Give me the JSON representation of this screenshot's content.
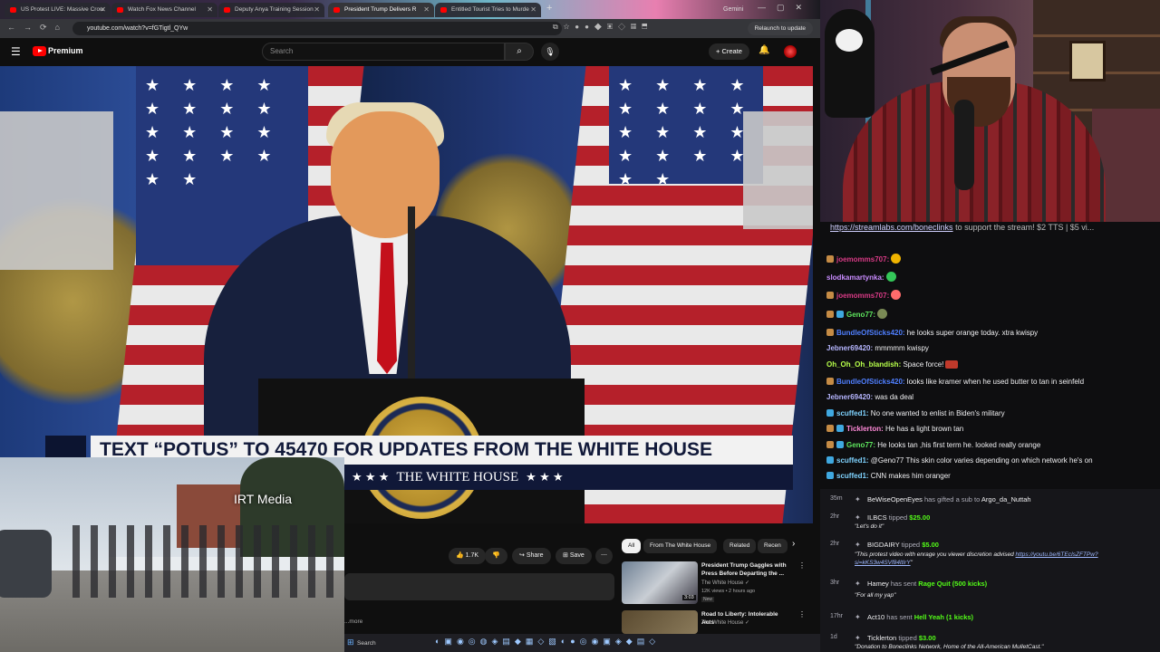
{
  "colors": {
    "youtube_red": "#ff0000",
    "chat_bg": "#0e0e10",
    "events_bg": "#16161a",
    "chyron_navy": "#101838"
  },
  "browser": {
    "tabs": [
      {
        "label": "US Protest LIVE: Massive Crow"
      },
      {
        "label": "Watch Fox News Channel"
      },
      {
        "label": "Deputy Anya Training Session"
      },
      {
        "label": "President Trump Delivers R"
      },
      {
        "label": "Entitled Tourist Tries to Murde"
      }
    ],
    "gemini_tab": "Gemini",
    "new_tab_icon": "plus-icon",
    "url": "youtube.com/watch?v=fGTigtl_QYw",
    "relaunch_label": "Relaunch to update"
  },
  "youtube": {
    "brand": "Premium",
    "search_placeholder": "Search",
    "create_label": "+ Create",
    "video": {
      "chyron_top": "TEXT “POTUS” TO 45470 FOR UPDATES FROM THE WHITE HOUSE",
      "chyron_bottom": "THE WHITE HOUSE",
      "chyron_stars_left": "★ ★ ★",
      "chyron_stars_right": "★ ★ ★",
      "canton_stars": "★ ★ ★ ★ ★ ★ ★ ★ ★ ★ ★ ★ ★ ★ ★ ★ ★ ★"
    },
    "actions": {
      "likes": "1.7K",
      "share": "Share",
      "save": "Save",
      "more": "⋯"
    },
    "more_link": "...more",
    "chips": [
      "All",
      "From The White House",
      "Related",
      "Recen"
    ],
    "recommendations": [
      {
        "title": "President Trump Gaggles with Press Before Departing the ...",
        "channel": "The White House ✓",
        "meta": "12K views • 2 hours ago",
        "badge": "New",
        "duration": "3:03"
      },
      {
        "title": "Road to Liberty: Intolerable Acts",
        "channel": "The White House ✓",
        "meta": "",
        "badge": "",
        "duration": ""
      }
    ]
  },
  "protest_cam": {
    "overlay_label": "IRT Media"
  },
  "taskbar": {
    "search_label": "Search"
  },
  "stream": {
    "promo_link": "https://streamlabs.com/boneclinks",
    "promo_text": " to support the stream! $2 TTS | $5 vi..."
  },
  "chat": [
    {
      "user": "joemomms707:",
      "color": "#d93b86",
      "text": "",
      "emote": "#f0b400"
    },
    {
      "user": "slodkamartynka:",
      "color": "#c98cff",
      "text": "",
      "emote": "#34c759"
    },
    {
      "user": "joemomms707:",
      "color": "#d93b86",
      "text": "",
      "emote": "#ff6b6b"
    },
    {
      "user": "Geno77:",
      "color": "#5ee55e",
      "text": "",
      "emote": "#7a8a55"
    },
    {
      "user": "BundleOfSticks420:",
      "color": "#4f7fff",
      "text": " he looks super orange today. xtra kwispy",
      "emote": ""
    },
    {
      "user": "Jebner69420:",
      "color": "#b6b6ff",
      "text": " mmmmm kwispy",
      "emote": ""
    },
    {
      "user": "Oh_Oh_Oh_blandish:",
      "color": "#b7ff4a",
      "text": " Space force!",
      "emote": "#c0392b"
    },
    {
      "user": "BundleOfSticks420:",
      "color": "#4f7fff",
      "text": " looks like kramer when he used butter to tan in seinfeld",
      "emote": ""
    },
    {
      "user": "Jebner69420:",
      "color": "#b6b6ff",
      "text": " was da deal",
      "emote": ""
    },
    {
      "user": "scuffed1:",
      "color": "#7fd3ff",
      "text": " No one wanted to enlist in Biden's military",
      "emote": ""
    },
    {
      "user": "Ticklerton:",
      "color": "#ff8ad8",
      "text": " He has a light brown tan",
      "emote": ""
    },
    {
      "user": "Geno77:",
      "color": "#5ee55e",
      "text": " He looks tan ,his first term he. looked really orange",
      "emote": ""
    },
    {
      "user": "scuffed1:",
      "color": "#7fd3ff",
      "text": " This skin color varies depending on which network he's on",
      "emote": ""
    },
    {
      "user": "scuffed1:",
      "color": "#7fd3ff",
      "text": " @Geno77 This skin color varies depending on which network he's on",
      "emote": ""
    },
    {
      "user": "scuffed1:",
      "color": "#7fd3ff",
      "text": " CNN makes him oranger",
      "emote": ""
    }
  ],
  "events": [
    {
      "time": "35m",
      "pre": "",
      "who": "BeWiseOpenEyes",
      "mid": " has gifted a sub to ",
      "target": "Argo_da_Nuttah",
      "amount": "",
      "sub": ""
    },
    {
      "time": "2hr",
      "pre": "",
      "who": "ILBCS",
      "mid": " tipped ",
      "target": "",
      "amount": "$25.00",
      "sub": "\"Let's do it\""
    },
    {
      "time": "2hr",
      "pre": "",
      "who": "BIGDAIRY",
      "mid": " tipped ",
      "target": "",
      "amount": "$5.00",
      "sub": "\"This protest video with enrage you viewer discretion advised ",
      "sub_link": "https://youtu.be/6TEcIsZFTPw?si=kKS3w4SVf84ltIrY",
      "sub2": "\""
    },
    {
      "time": "3hr",
      "pre": "",
      "who": "Hamey",
      "mid": " has sent ",
      "target": "Rage Quit (500 kicks)",
      "amount": "",
      "sub": "\"For all my yap\""
    },
    {
      "time": "17hr",
      "pre": "",
      "who": "Act10",
      "mid": " has sent ",
      "target": "Hell Yeah (1 kicks)",
      "amount": "",
      "sub": ""
    },
    {
      "time": "1d",
      "pre": "",
      "who": "Ticklerton",
      "mid": " tipped ",
      "target": "",
      "amount": "$3.00",
      "sub": "\"Donation to Boneclinks Network, Home of the All-American MulletCast.\""
    }
  ]
}
